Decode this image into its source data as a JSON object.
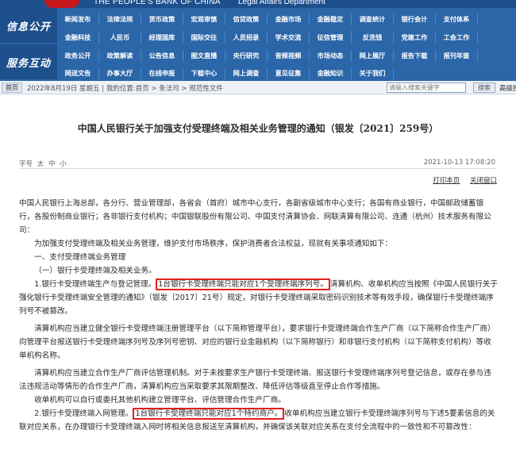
{
  "header": {
    "site_name_en": "THE PEOPLE'S BANK OF CHINA",
    "dept_en": "Legal Affairs Department"
  },
  "nav": {
    "side_labels": [
      "信息公开",
      "服务互动"
    ],
    "row0": [
      "新闻发布",
      "法律法规",
      "货币政策",
      "宏观审慎",
      "信贷政策",
      "金融市场",
      "金融稳定",
      "调查统计",
      "银行会计",
      "支付体系"
    ],
    "row1": [
      "金融科技",
      "人民币",
      "经理国库",
      "国际交往",
      "人员招录",
      "学术交流",
      "征信管理",
      "反洗钱",
      "党建工作",
      "工会工作"
    ],
    "row2": [
      "政务公开",
      "政策解读",
      "公告信息",
      "图文直播",
      "央行研究",
      "音频视频",
      "市场动态",
      "网上展厅",
      "报告下载",
      "报刊年鉴"
    ],
    "row3": [
      "网送文告",
      "办事大厅",
      "在线申报",
      "下载中心",
      "网上调查",
      "意见征集",
      "金融知识",
      "关于我们"
    ]
  },
  "statusbar": {
    "home_label": "首页",
    "breadcrumb": "2022年8月19日 星期五 | 我的位置:首页 > 条法司 > 规范性文件",
    "search_placeholder": "请输入搜索关键字",
    "search_button": "搜索",
    "advanced_search": "高级搜索"
  },
  "article": {
    "title": "中国人民银行关于加强支付受理终端及相关业务管理的通知（银发〔2021〕259号）",
    "font_size_label": "字号",
    "font_sizes": [
      "太",
      "中",
      "小"
    ],
    "date": "2021-10-13 17:08:20",
    "print_label": "打印本页",
    "close_label": "关闭窗口",
    "p1": "中国人民银行上海总部，各分行、营业管理部，各省会（首府）城市中心支行，各副省级城市中心支行；各国有商业银行，中国邮政储蓄银行，各股份制商业银行；各非银行支付机构；中国银联股份有限公司、中国支付清算协会、网联清算有限公司、连通（杭州）技术服务有限公司：",
    "p2": "为加强支付受理终端及相关业务管理，维护支付市场秩序，保护消费者合法权益，现就有关事项通知如下：",
    "p3": "一、支付受理终端业务管理",
    "p4": "（一）银行卡受理终端及相关业务。",
    "p5_a": "1.银行卡受理终端生产与登记管理。",
    "p5_hl": "1台银行卡受理终端只能对应1个受理终端序列号。",
    "p5_b": "清算机构、收单机构应当按照《中国人民银行关于强化银行卡受理终端安全管理的通知》（银发〔2017〕21号）规定，对银行卡受理终端采取密码识别技术等有效手段，确保银行卡受理终端序列号不被篡改。",
    "p6": "清算机构应当建立健全银行卡受理终端注册管理平台（以下简称管理平台），要求银行卡受理终端合作生产厂商（以下简称合作生产厂商）向管理平台报送银行卡受理终端序列号及序列号密钥、对应的银行业金融机构（以下简称银行）和非银行支付机构（以下简称支付机构）等收单机构名称。",
    "p7": "清算机构应当建立合作生产厂商评估管理机制。对于未按要求生产银行卡受理终端、报送银行卡受理终端序列号登记信息，或存在参与违法违规活动等情形的合作生产厂商，清算机构应当采取要求其限期整改、降低评估等级直至停止合作等措施。",
    "p8": "收单机构可以自行或委托其他机构建立管理平台、评估管理合作生产厂商。",
    "p9_a": "2.银行卡受理终端入网管理。",
    "p9_hl": "1台银行卡受理终端只能对应1个特约商户。",
    "p9_b": "收单机构应当建立银行卡受理终端序列号与下述5要素信息的关联对应关系，在办理银行卡受理终端入网时将相关信息报送至清算机构，并确保该关联对应关系在支付全流程中的一致性和不可篡改性："
  }
}
